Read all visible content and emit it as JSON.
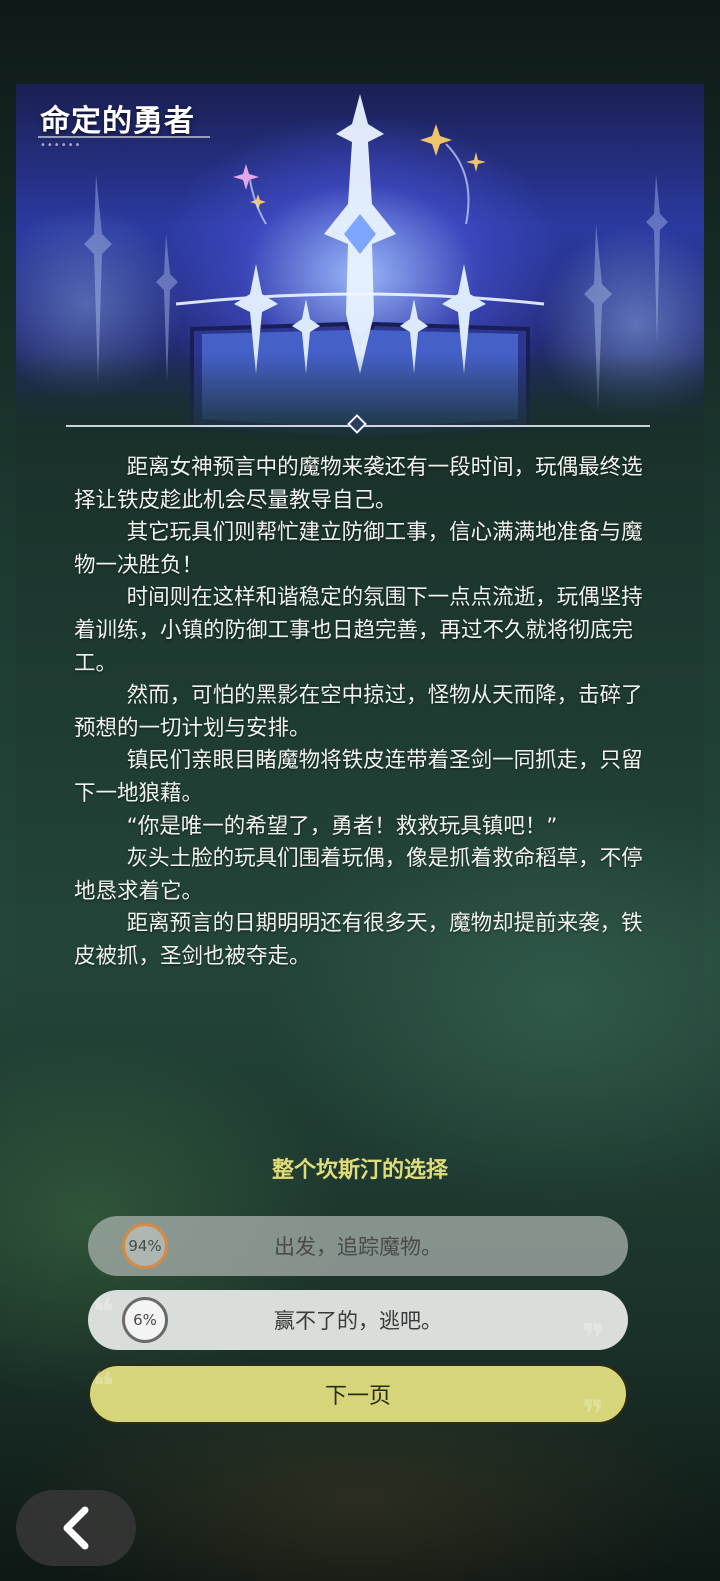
{
  "event": {
    "title": "命定的勇者",
    "title_dots": "••••••",
    "paragraphs": [
      "距离女神预言中的魔物来袭还有一段时间，玩偶最终选择让铁皮趁此机会尽量教导自己。",
      "其它玩具们则帮忙建立防御工事，信心满满地准备与魔物一决胜负！",
      "时间则在这样和谐稳定的氛围下一点点流逝，玩偶坚持着训练，小镇的防御工事也日趋完善，再过不久就将彻底完工。",
      "然而，可怕的黑影在空中掠过，怪物从天而降，击碎了预想的一切计划与安排。",
      "镇民们亲眼目睹魔物将铁皮连带着圣剑一同抓走，只留下一地狼藉。",
      "“你是唯一的希望了，勇者！救救玩具镇吧！”",
      "灰头土脸的玩具们围着玩偶，像是抓着救命稻草，不停地恳求着它。",
      "距离预言的日期明明还有很多天，魔物却提前来袭，铁皮被抓，圣剑也被夺走。"
    ]
  },
  "choices": {
    "heading": "整个坎斯汀的选择",
    "options": [
      {
        "percent": "94%",
        "fraction": 0.94,
        "label": "出发，追踪魔物。"
      },
      {
        "percent": "6%",
        "fraction": 0.06,
        "label": "赢不了的，逃吧。"
      }
    ],
    "next_label": "下一页"
  },
  "nav": {
    "back_icon": "chevron-left-icon"
  },
  "colors": {
    "heading": "#e0dc7a",
    "next_button": "#d6d57a",
    "ring_majority": "#d58a45",
    "ring_minority": "#6a6a6a"
  }
}
